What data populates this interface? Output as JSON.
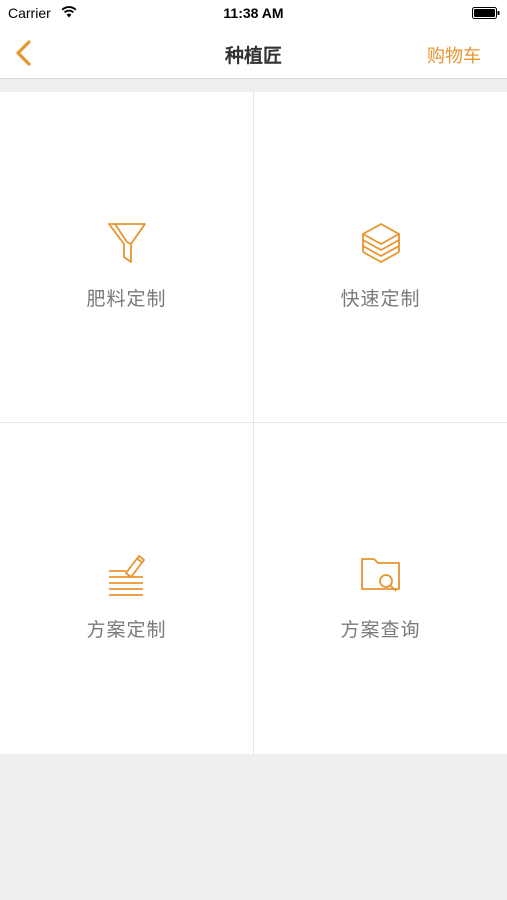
{
  "status_bar": {
    "carrier": "Carrier",
    "time": "11:38 AM"
  },
  "nav": {
    "title": "种植匠",
    "cart_label": "购物车",
    "back_icon": "chevron-left-icon"
  },
  "colors": {
    "accent": "#e8942f",
    "text_primary": "#333333",
    "text_secondary": "#7a7a7a",
    "background": "#efeff0"
  },
  "menu": [
    {
      "label": "肥料定制",
      "icon": "funnel-icon"
    },
    {
      "label": "快速定制",
      "icon": "layers-icon"
    },
    {
      "label": "方案定制",
      "icon": "edit-lines-icon"
    },
    {
      "label": "方案查询",
      "icon": "folder-search-icon"
    }
  ]
}
